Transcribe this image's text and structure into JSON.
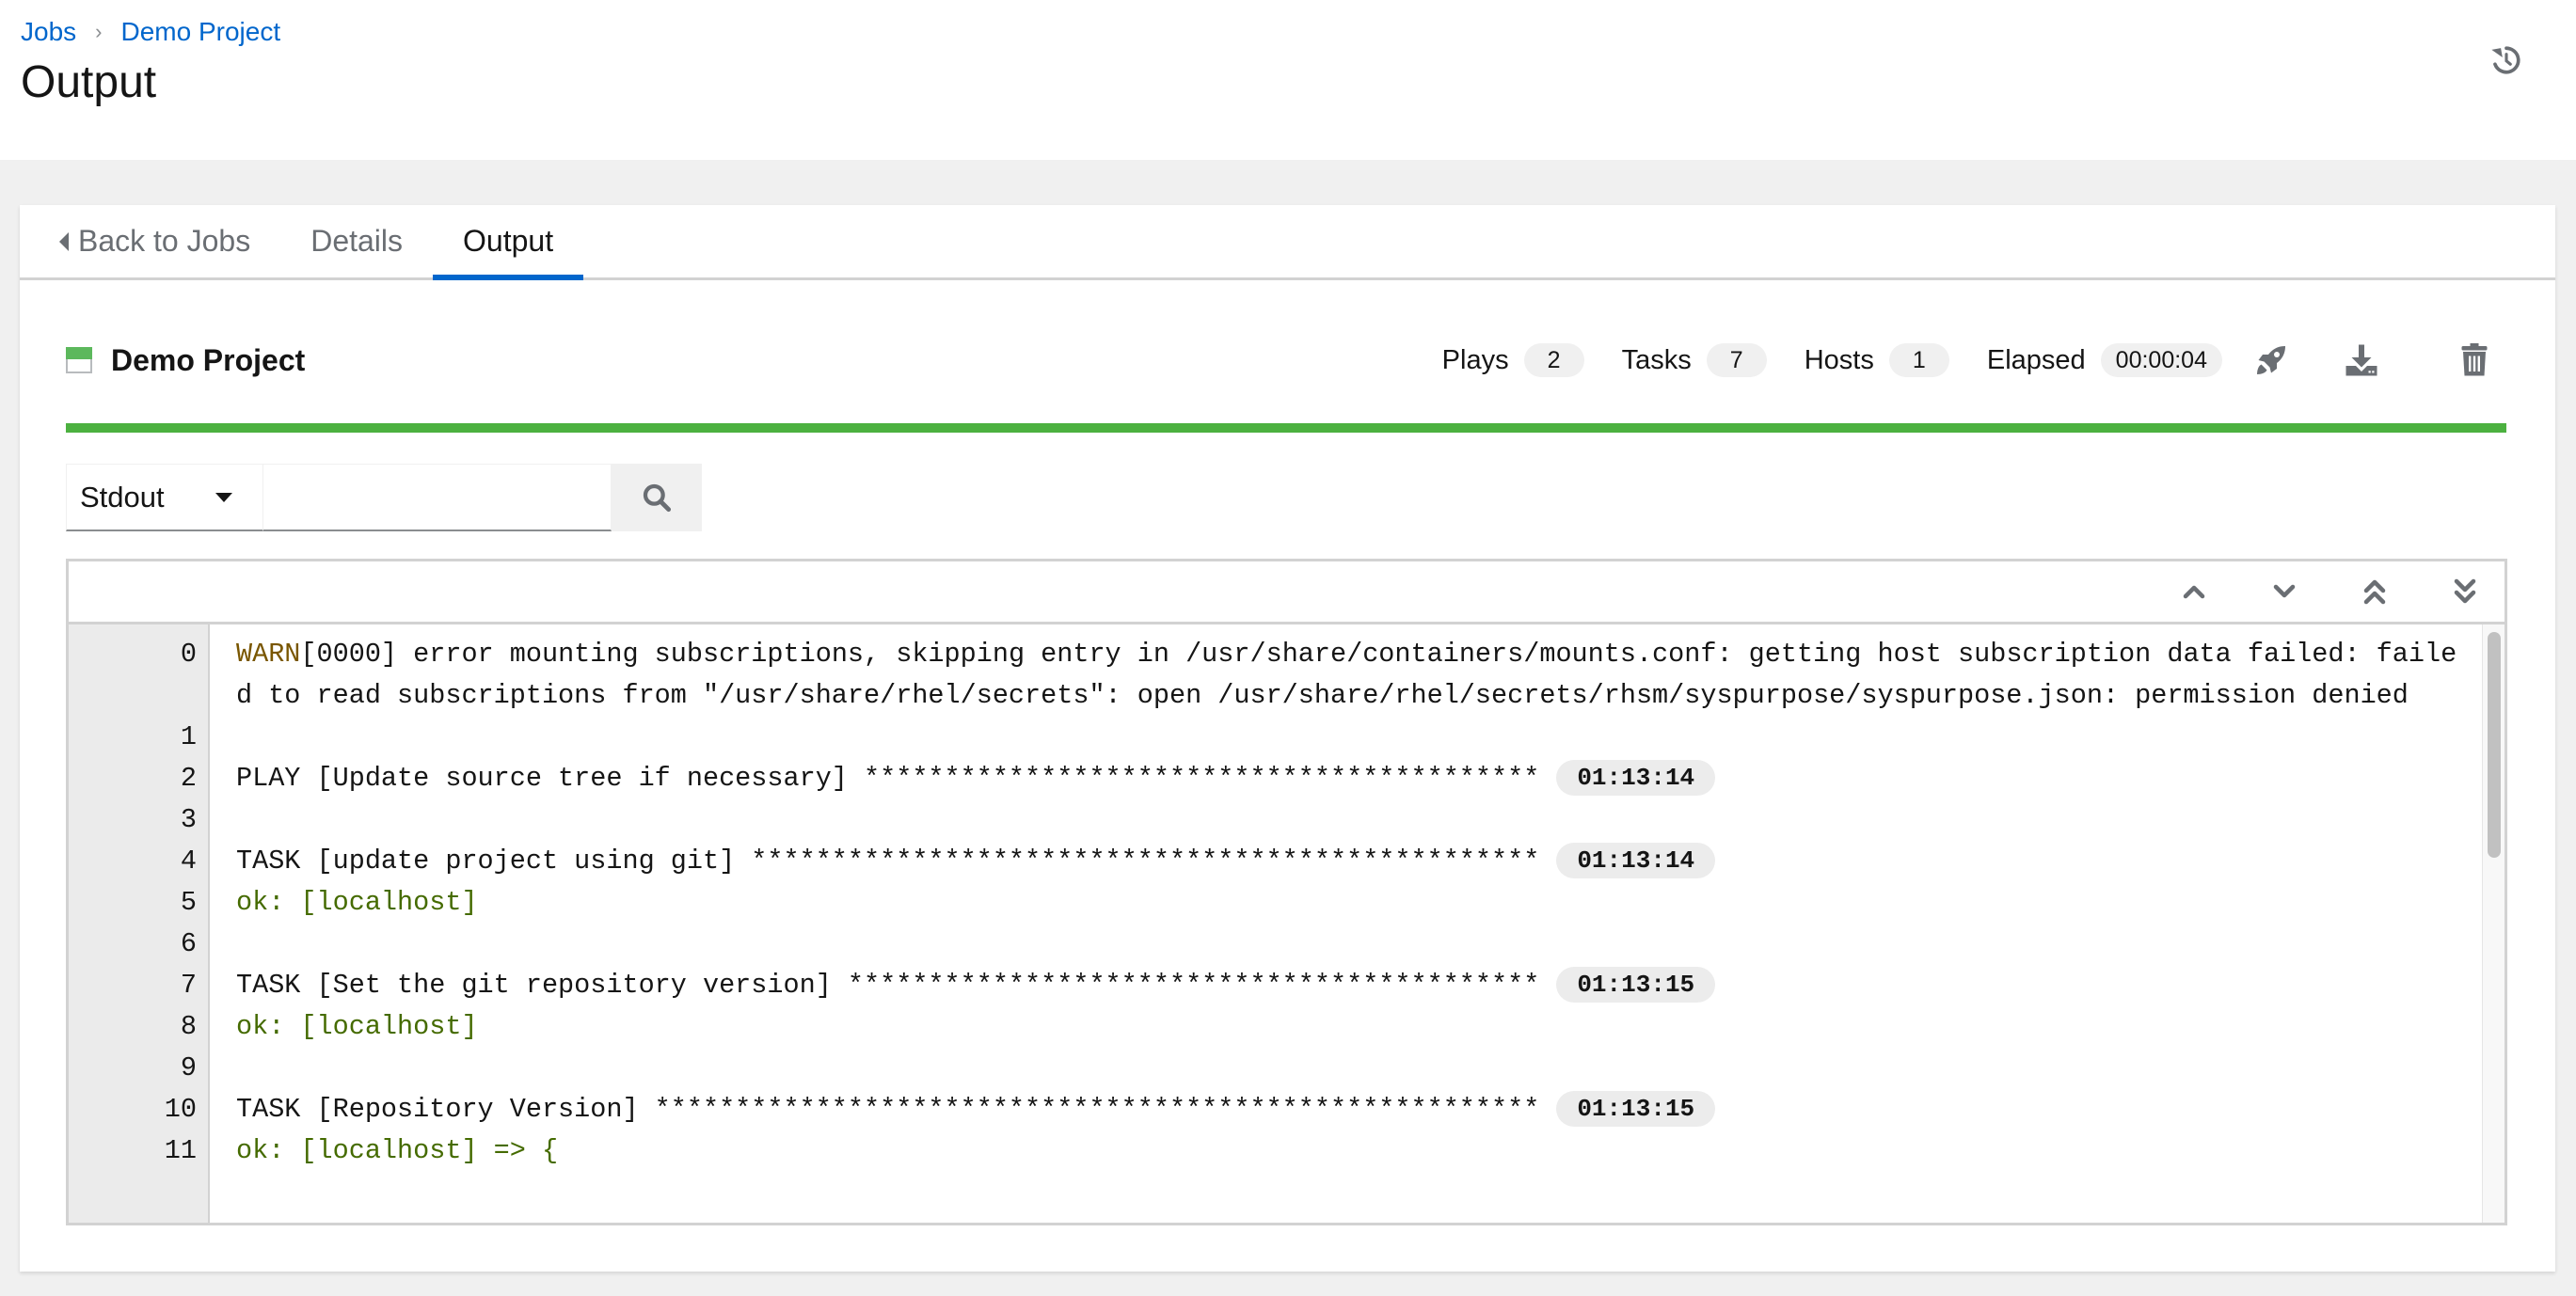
{
  "header": {
    "breadcrumb": [
      {
        "label": "Jobs"
      },
      {
        "label": "Demo Project"
      }
    ],
    "breadcrumb_separator": "›",
    "title": "Output",
    "history_icon": "history-icon"
  },
  "tabs": [
    {
      "label": "Back to Jobs",
      "icon": "caret-left-icon",
      "active": false
    },
    {
      "label": "Details",
      "active": false
    },
    {
      "label": "Output",
      "active": true
    }
  ],
  "job": {
    "name": "Demo Project",
    "status": "successful",
    "status_color": "#5cb85c",
    "stats": [
      {
        "label": "Plays",
        "value": "2"
      },
      {
        "label": "Tasks",
        "value": "7"
      },
      {
        "label": "Hosts",
        "value": "1"
      },
      {
        "label": "Elapsed",
        "value": "00:00:04"
      }
    ],
    "actions": [
      {
        "name": "relaunch",
        "icon": "rocket-icon"
      },
      {
        "name": "download",
        "icon": "download-icon"
      },
      {
        "name": "delete",
        "icon": "trash-icon"
      }
    ],
    "progress_percent": 100,
    "progress_color": "#4cb140"
  },
  "search": {
    "filter_selected": "Stdout",
    "query_value": "",
    "query_placeholder": "",
    "search_icon": "search-icon"
  },
  "output": {
    "nav_buttons": [
      {
        "name": "scroll-previous",
        "icon": "angle-up-icon"
      },
      {
        "name": "scroll-next",
        "icon": "angle-down-icon"
      },
      {
        "name": "scroll-first",
        "icon": "angle-double-up-icon"
      },
      {
        "name": "scroll-last",
        "icon": "angle-double-down-icon"
      }
    ],
    "lines": [
      {
        "num": "0",
        "prefix": "WARN",
        "text": "[0000] error mounting subscriptions, skipping entry in /usr/share/containers/mounts.conf: getting host subscription data failed: failed to read subscriptions from \"/usr/share/rhel/secrets\": open /usr/share/rhel/secrets/rhsm/syspurpose/syspurpose.json: permission denied",
        "type": "warn"
      },
      {
        "num": "1",
        "text": "",
        "type": "plain"
      },
      {
        "num": "2",
        "text": "PLAY [Update source tree if necessary] ******************************************",
        "time": "01:13:14",
        "type": "plain"
      },
      {
        "num": "3",
        "text": "",
        "type": "plain"
      },
      {
        "num": "4",
        "text": "TASK [update project using git] *************************************************",
        "time": "01:13:14",
        "type": "plain"
      },
      {
        "num": "5",
        "text": "ok: [localhost]",
        "type": "ok"
      },
      {
        "num": "6",
        "text": "",
        "type": "plain"
      },
      {
        "num": "7",
        "text": "TASK [Set the git repository version] *******************************************",
        "time": "01:13:15",
        "type": "plain"
      },
      {
        "num": "8",
        "text": "ok: [localhost]",
        "type": "ok"
      },
      {
        "num": "9",
        "text": "",
        "type": "plain"
      },
      {
        "num": "10",
        "text": "TASK [Repository Version] *******************************************************",
        "time": "01:13:15",
        "type": "plain"
      },
      {
        "num": "11",
        "text": "ok: [localhost] => {",
        "type": "ok"
      }
    ]
  }
}
